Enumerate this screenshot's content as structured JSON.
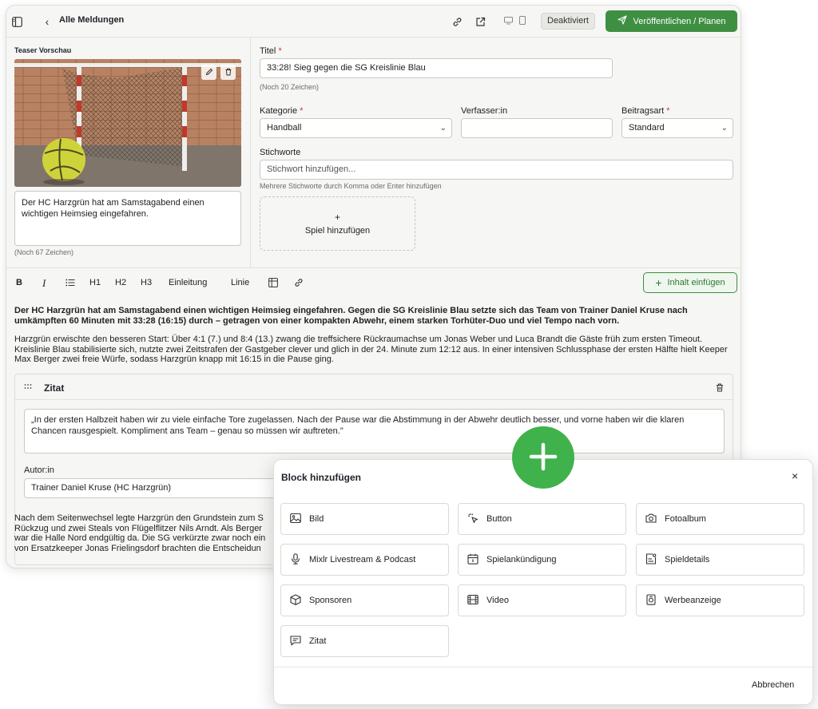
{
  "header": {
    "back_label": "Alle Meldungen",
    "status_badge": "Deaktiviert",
    "publish_label": "Veröffentlichen / Planen"
  },
  "teaser": {
    "label": "Teaser Vorschau",
    "text": "Der HC Harzgrün hat am Samstagabend einen wichtigen Heimsieg eingefahren.",
    "chars_left": "(Noch 67 Zeichen)"
  },
  "form": {
    "title_label": "Titel",
    "title_value": "33:28! Sieg gegen die SG Kreislinie Blau",
    "title_chars_left": "(Noch 20 Zeichen)",
    "category_label": "Kategorie",
    "category_value": "Handball",
    "author_label": "Verfasser:in",
    "author_value": "",
    "post_type_label": "Beitragsart",
    "post_type_value": "Standard",
    "tags_label": "Stichworte",
    "tags_placeholder": "Stichwort hinzufügen...",
    "tags_hint": "Mehrere Stichworte durch Komma oder Enter hinzufügen",
    "add_game_plus": "+",
    "add_game_label": "Spiel hinzufügen"
  },
  "editor_toolbar": {
    "bold": "B",
    "italic": "I",
    "h1": "H1",
    "h2": "H2",
    "h3": "H3",
    "intro": "Einleitung",
    "line": "Linie",
    "insert_content": "Inhalt einfügen"
  },
  "content": {
    "lead": "Der HC Harzgrün hat am Samstagabend einen wichtigen Heimsieg eingefahren. Gegen die SG Kreislinie Blau setzte sich das Team von Trainer Daniel Kruse nach umkämpften 60 Minuten mit 33:28 (16:15) durch – getragen von einer kompakten Abwehr, einem starken Torhüter-Duo und viel Tempo nach vorn.",
    "paragraph1": "Harzgrün erwischte den besseren Start: Über 4:1 (7.) und 8:4 (13.) zwang die treffsichere Rückraumachse um Jonas Weber und Luca Brandt die Gäste früh zum ersten Timeout. Kreislinie Blau stabilisierte sich, nutzte zwei Zeitstrafen der Gastgeber clever und glich in der 24. Minute zum 12:12 aus. In einer intensiven Schlussphase der ersten Hälfte hielt Keeper Max Berger zwei freie Würfe, sodass Harzgrün knapp mit 16:15 in die Pause ging.",
    "quote_block_title": "Zitat",
    "quote_text": "„In der ersten Halbzeit haben wir zu viele einfache Tore zugelassen. Nach der Pause war die Abstimmung in der Abwehr deutlich besser, und vorne haben wir die klaren Chancen rausgespielt. Kompliment ans Team – genau so müssen wir auftreten.\"",
    "quote_author_label": "Autor:in",
    "quote_author_value": "Trainer Daniel Kruse (HC Harzgrün)",
    "paragraph2_lines": [
      "Nach dem Seitenwechsel legte Harzgrün den Grundstein zum S",
      "Rückzug und zwei Steals von Flügelflitzer Nils Arndt. Als Berger",
      "war die Halle Nord endgültig da. Die SG verkürzte zwar noch ein",
      "von Ersatzkeeper Jonas Frielingsdorf brachten die Entscheidun"
    ]
  },
  "modal": {
    "title": "Block hinzufügen",
    "close": "×",
    "options": [
      {
        "label": "Bild",
        "icon": "image-icon"
      },
      {
        "label": "Button",
        "icon": "pointer-click-icon"
      },
      {
        "label": "Fotoalbum",
        "icon": "camera-icon"
      },
      {
        "label": "Mixlr Livestream & Podcast",
        "icon": "microphone-icon"
      },
      {
        "label": "Spielankündigung",
        "icon": "calendar-icon"
      },
      {
        "label": "Spieldetails",
        "icon": "scoreboard-icon"
      },
      {
        "label": "Sponsoren",
        "icon": "box-icon"
      },
      {
        "label": "Video",
        "icon": "film-icon"
      },
      {
        "label": "Werbeanzeige",
        "icon": "ad-icon"
      },
      {
        "label": "Zitat",
        "icon": "quote-message-icon"
      }
    ],
    "cancel": "Abbrechen"
  },
  "colors": {
    "primary": "#3f8f43",
    "fab": "#3fb24b",
    "required": "#d0312d"
  }
}
